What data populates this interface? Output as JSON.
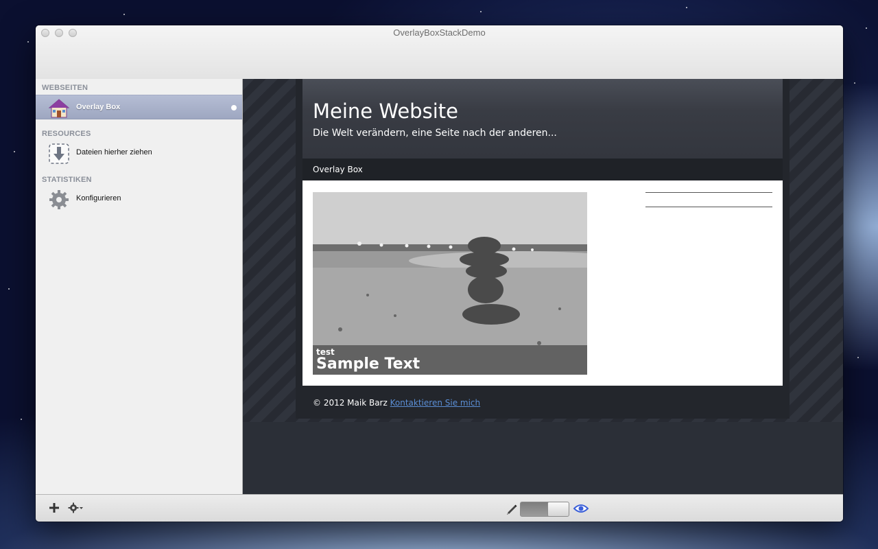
{
  "window": {
    "title": "OverlayBoxStackDemo"
  },
  "sidebar": {
    "sections": [
      {
        "heading": "WEBSEITEN",
        "items": [
          {
            "label": "Overlay Box",
            "icon": "house-icon",
            "selected": true
          }
        ]
      },
      {
        "heading": "RESOURCES",
        "items": [
          {
            "label": "Dateien hierher ziehen",
            "icon": "download-arrow-icon",
            "selected": false
          }
        ]
      },
      {
        "heading": "STATISTIKEN",
        "items": [
          {
            "label": "Konfigurieren",
            "icon": "gear-icon",
            "selected": false
          }
        ]
      }
    ]
  },
  "bottombar": {
    "add_icon": "plus-icon",
    "settings_icon": "gear-menu-icon",
    "edit_icon": "pencil-icon",
    "preview_icon": "eye-icon",
    "preview_mode_on": true
  },
  "site": {
    "title": "Meine Website",
    "subtitle": "Die Welt verändern, eine Seite nach der anderen...",
    "nav_item": "Overlay Box",
    "overlay_small": "test",
    "overlay_big": "Sample Text",
    "footer_text": "© 2012 Maik Barz",
    "footer_link": "Kontaktieren Sie mich"
  },
  "colors": {
    "selection": "#a7b0c9",
    "link": "#5b8fd6",
    "eye": "#3a5fd9"
  }
}
